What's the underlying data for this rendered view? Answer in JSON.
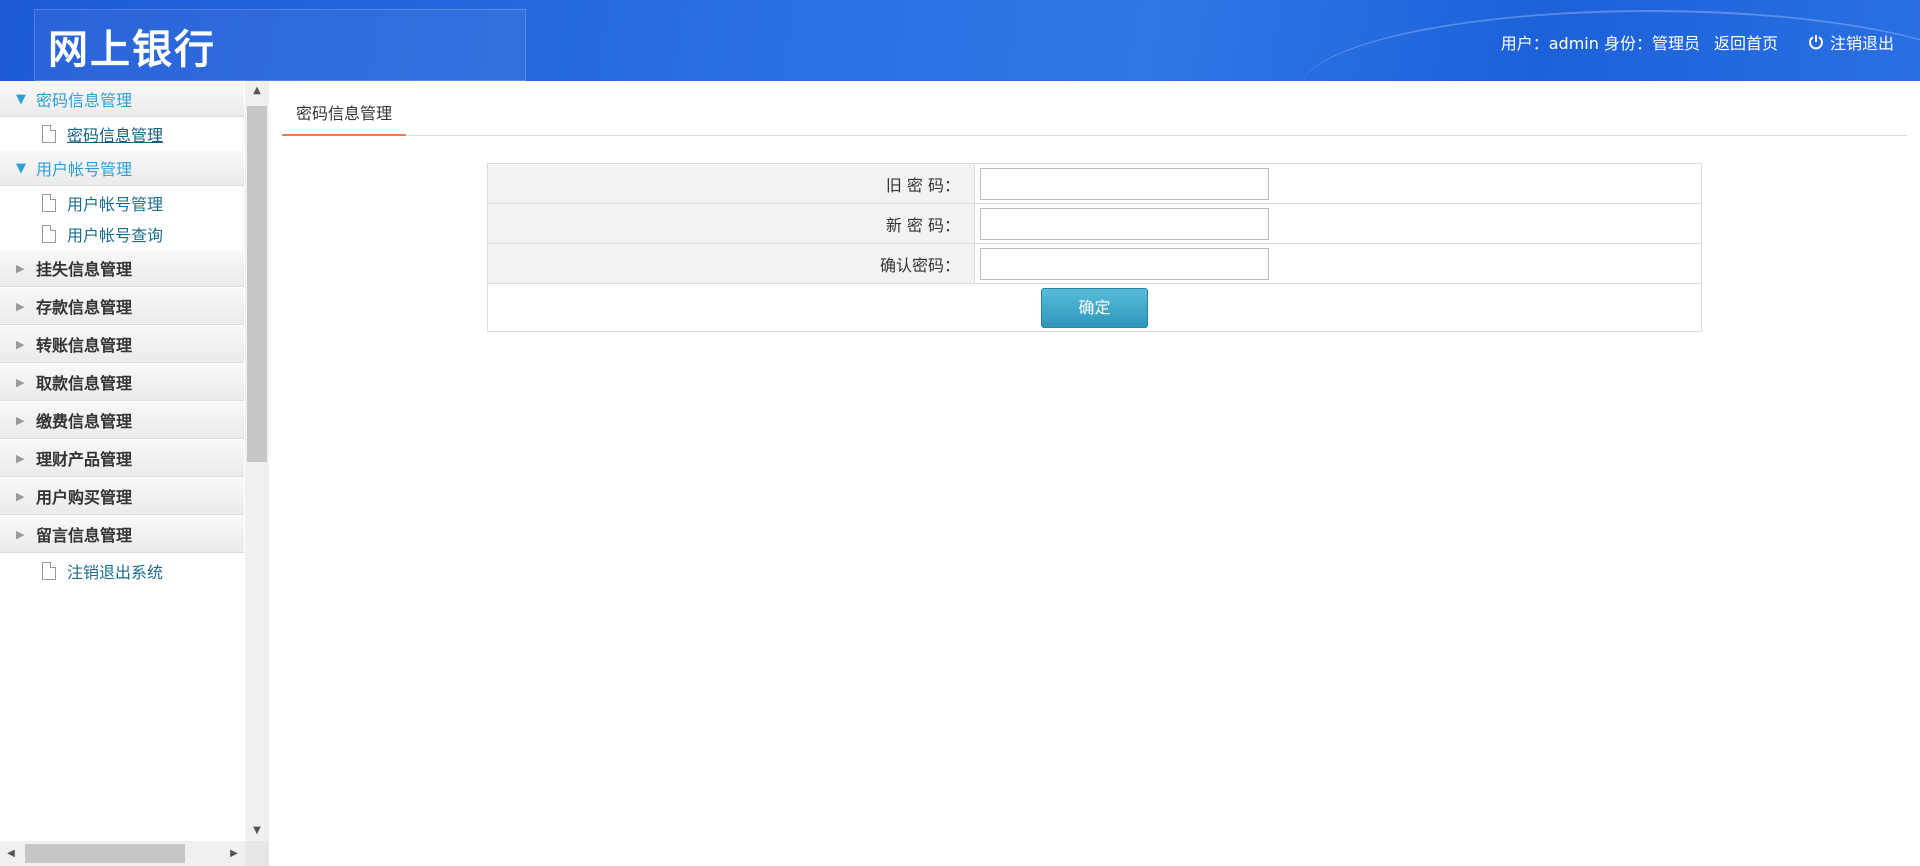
{
  "header": {
    "logo": "网上银行",
    "user_info": "用户：admin 身份：管理员",
    "home_link": "返回首页",
    "logout_link": "注销退出"
  },
  "sidebar": {
    "groups": [
      {
        "label": "密码信息管理",
        "open": true,
        "items": [
          {
            "label": "密码信息管理",
            "active": true
          }
        ]
      },
      {
        "label": "用户帐号管理",
        "open": true,
        "items": [
          {
            "label": "用户帐号管理"
          },
          {
            "label": "用户帐号查询"
          }
        ]
      },
      {
        "label": "挂失信息管理",
        "open": false
      },
      {
        "label": "存款信息管理",
        "open": false
      },
      {
        "label": "转账信息管理",
        "open": false
      },
      {
        "label": "取款信息管理",
        "open": false
      },
      {
        "label": "缴费信息管理",
        "open": false
      },
      {
        "label": "理财产品管理",
        "open": false
      },
      {
        "label": "用户购买管理",
        "open": false
      },
      {
        "label": "留言信息管理",
        "open": false
      }
    ],
    "footer_item": "注销退出系统"
  },
  "main": {
    "tab": "密码信息管理",
    "form": {
      "old_password_label": "旧 密 码：",
      "new_password_label": "新 密 码：",
      "confirm_password_label": "确认密码：",
      "old_password_value": "",
      "new_password_value": "",
      "confirm_password_value": "",
      "submit_label": "确定"
    }
  },
  "colors": {
    "header_blue": "#2a6fe2",
    "open_group": "#2f9fd4",
    "tab_underline": "#ff7a2a",
    "button": "#3aa6c8"
  }
}
